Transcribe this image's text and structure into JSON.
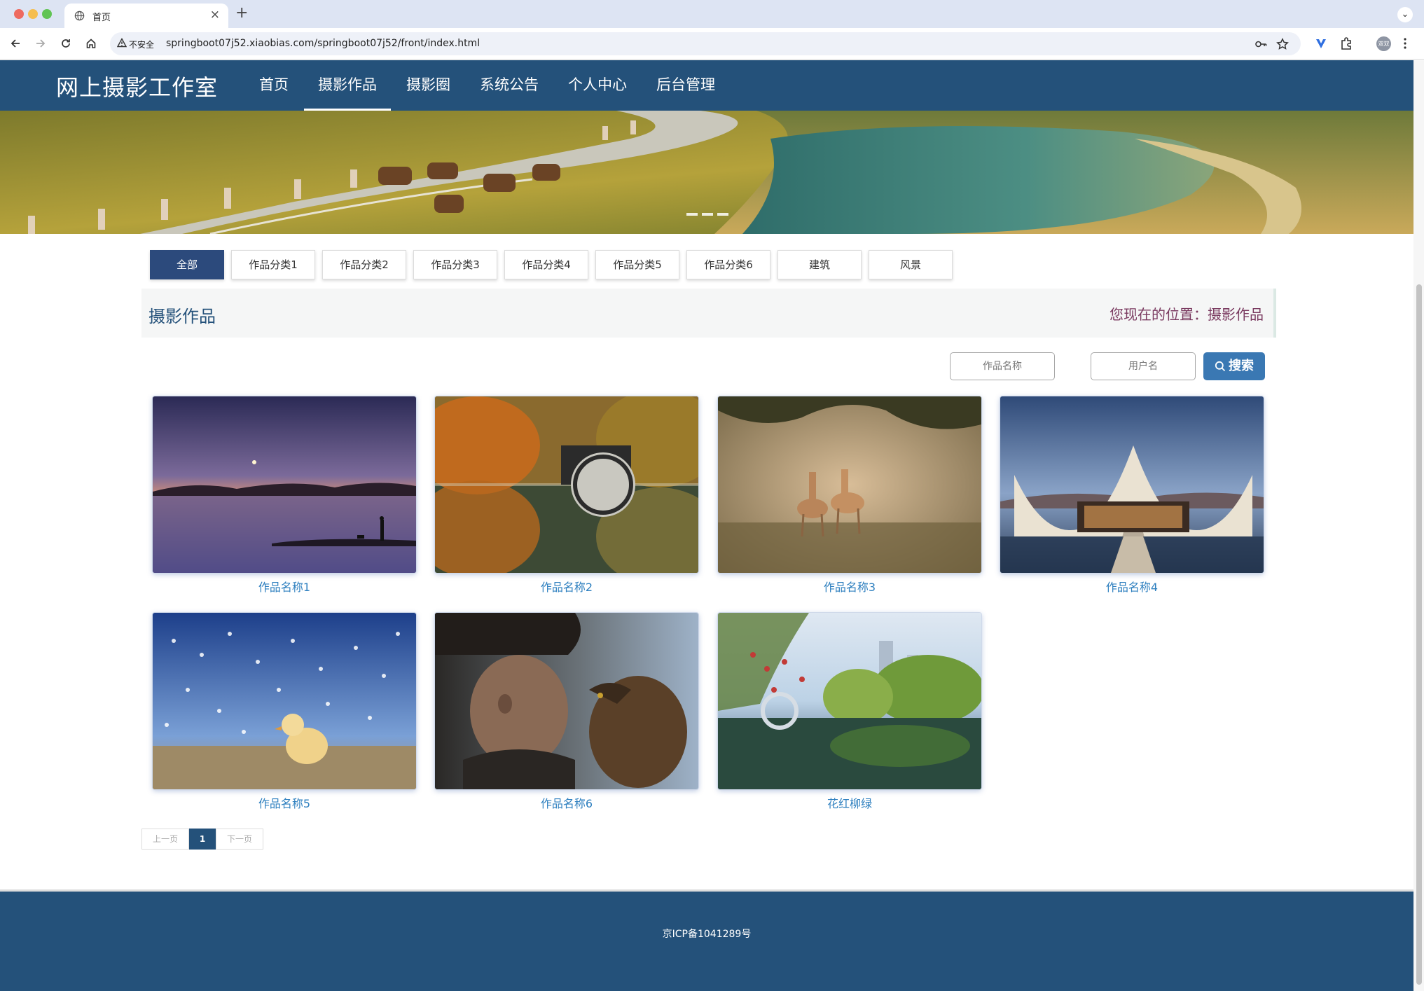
{
  "browser": {
    "tab_title": "首页",
    "insecure_label": "不安全",
    "url": "springboot07j52.xiaobias.com/springboot07j52/front/index.html",
    "avatar_text": "双双"
  },
  "site": {
    "title": "网上摄影工作室",
    "nav": [
      {
        "label": "首页"
      },
      {
        "label": "摄影作品"
      },
      {
        "label": "摄影圈"
      },
      {
        "label": "系统公告"
      },
      {
        "label": "个人中心"
      },
      {
        "label": "后台管理"
      }
    ],
    "active_nav": "摄影作品"
  },
  "categories": [
    "全部",
    "作品分类1",
    "作品分类2",
    "作品分类3",
    "作品分类4",
    "作品分类5",
    "作品分类6",
    "建筑",
    "风景"
  ],
  "section": {
    "title": "摄影作品",
    "breadcrumb": "您现在的位置：摄影作品"
  },
  "search": {
    "work_name_placeholder": "作品名称",
    "username_placeholder": "用户名",
    "button_label": "搜索"
  },
  "works": [
    {
      "name": "作品名称1",
      "scene": "lake-dusk"
    },
    {
      "name": "作品名称2",
      "scene": "autumn-bridge"
    },
    {
      "name": "作品名称3",
      "scene": "deer-meadow"
    },
    {
      "name": "作品名称4",
      "scene": "wave-architecture"
    },
    {
      "name": "作品名称5",
      "scene": "chick-birds"
    },
    {
      "name": "作品名称6",
      "scene": "man-eagle"
    },
    {
      "name": "花红柳绿",
      "scene": "spring-park"
    }
  ],
  "pagination": {
    "prev": "上一页",
    "current": "1",
    "next": "下一页"
  },
  "footer": {
    "icp": "京ICP备1041289号"
  },
  "colors": {
    "primary": "#24517a",
    "category_active": "#2c4a7c",
    "link": "#2d7fbf",
    "breadcrumb": "#7a3a60",
    "search_button": "#3a78b3"
  }
}
